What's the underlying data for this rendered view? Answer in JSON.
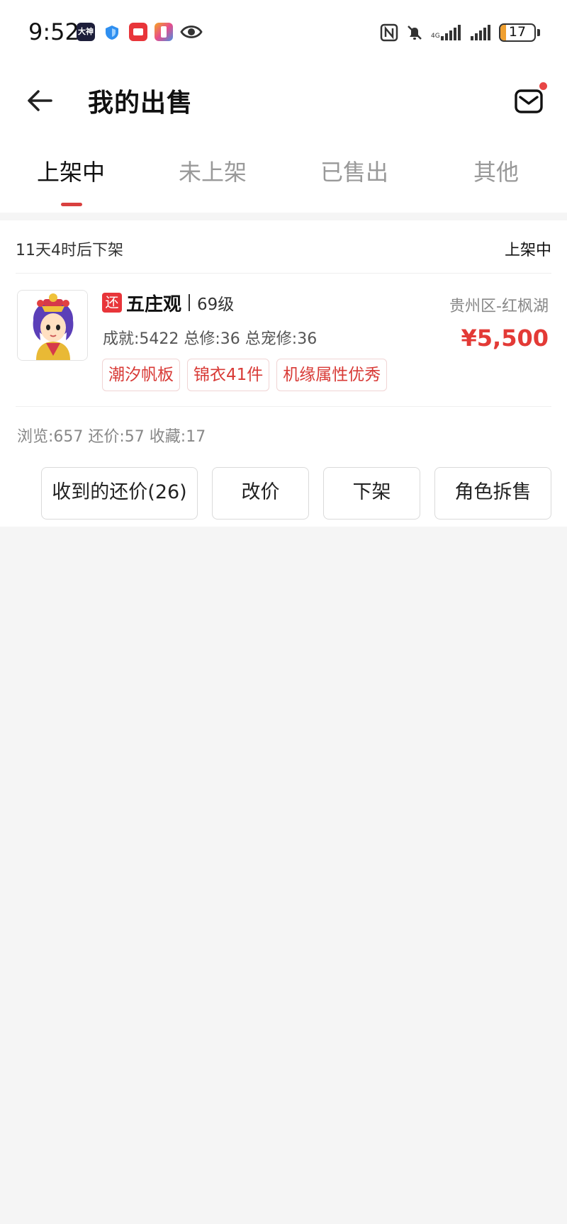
{
  "status_bar": {
    "time": "9:52",
    "left_icons": [
      "dashen-app-icon",
      "shield-app-icon",
      "red-app-icon",
      "gradient-app-icon",
      "eye-icon"
    ],
    "dashen_label": "大神",
    "right_icons": [
      "nfc-icon",
      "mute-bell-icon",
      "signal-4g-icon",
      "signal-icon",
      "battery-icon"
    ],
    "battery_level": "17",
    "battery_fraction": 0.17,
    "colors": {
      "battery_fill": "#f0a030"
    }
  },
  "header": {
    "title": "我的出售",
    "back_icon": "arrow-left-icon",
    "message_icon": "envelope-icon",
    "message_badge_color": "#e84545"
  },
  "tabs": {
    "items": [
      {
        "label": "上架中",
        "active": true
      },
      {
        "label": "未上架",
        "active": false
      },
      {
        "label": "已售出",
        "active": false
      },
      {
        "label": "其他",
        "active": false
      }
    ],
    "accent_color": "#d9403f"
  },
  "listing": {
    "expire_text": "11天4时后下架",
    "status": "上架中",
    "return_badge": "还",
    "role_name": "五庄观",
    "level": "69级",
    "server": "贵州区-红枫湖",
    "stats": "成就:5422 总修:36 总宠修:36",
    "price": "¥5,500",
    "price_color": "#e33a36",
    "tags": [
      "潮汐帆板",
      "锦衣41件",
      "机缘属性优秀"
    ],
    "view_stats": "浏览:657 还价:57 收藏:17",
    "actions": {
      "offers": "收到的还价(26)",
      "change_price": "改价",
      "delist": "下架",
      "split_sale": "角色拆售"
    }
  }
}
